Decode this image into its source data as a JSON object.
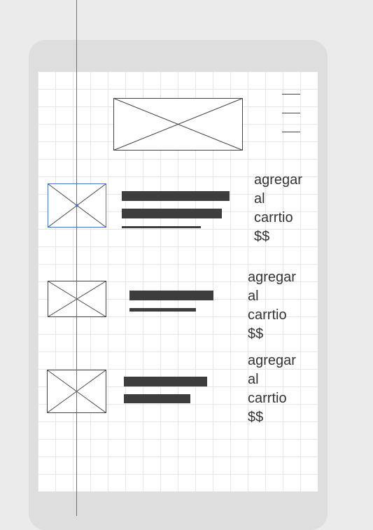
{
  "header": {
    "logo_icon": "image-placeholder-icon",
    "menu_icon": "hamburger-menu-icon"
  },
  "products": [
    {
      "thumbnail_icon": "image-placeholder-icon",
      "action": {
        "line1": "agregar",
        "line2": "al",
        "line3": "carrtio",
        "line4": "$$"
      }
    },
    {
      "thumbnail_icon": "image-placeholder-icon",
      "action": {
        "line1": "agregar",
        "line2": "al",
        "line3": "carrtio",
        "line4": "$$"
      }
    },
    {
      "thumbnail_icon": "image-placeholder-icon",
      "action": {
        "line1": "agregar",
        "line2": "al",
        "line3": "carrtio",
        "line4": "$$"
      }
    }
  ],
  "colors": {
    "canvas": "#ebebeb",
    "device_frame": "#dedede",
    "screen": "#ffffff",
    "grid": "#e6e6e6",
    "guide": "#4a74c8",
    "text_block": "#3d3d3d",
    "selection": "#4a74c8"
  }
}
